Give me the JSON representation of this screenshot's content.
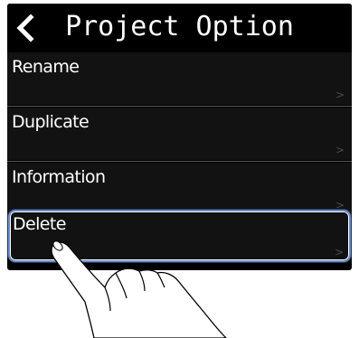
{
  "header": {
    "title": "Project Option",
    "back_icon": "chevron-left-icon"
  },
  "menu": {
    "items": [
      {
        "label": "Rename",
        "chevron": ">"
      },
      {
        "label": "Duplicate",
        "chevron": ">"
      },
      {
        "label": "Information",
        "chevron": ">"
      },
      {
        "label": "Delete",
        "chevron": ">",
        "selected": true
      }
    ]
  },
  "colors": {
    "screen_bg": "#000000",
    "row_bg": "#121212",
    "text": "#ffffff",
    "selection_outline": "#6c8fc4"
  }
}
